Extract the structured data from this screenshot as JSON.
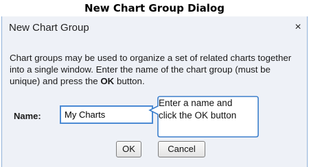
{
  "page": {
    "title": "New Chart Group Dialog"
  },
  "dialog": {
    "title": "New Chart Group",
    "close_glyph": "×",
    "message_part1": "Chart groups may be used to organize a set of related charts together into a single window. Enter the name of the chart group (must be unique) and press the ",
    "message_bold": "OK",
    "message_part2": " button.",
    "name_label": "Name:",
    "name_value": "My Charts",
    "callout_line1": "Enter a name and",
    "callout_line2": "click the OK button",
    "ok_label": "OK",
    "cancel_label": "Cancel"
  },
  "colors": {
    "dialog_background": "#eef1f7",
    "dialog_border": "#8fb0d8",
    "input_focus_border": "#4a8ad4",
    "callout_border": "#3b7ecb"
  },
  "icons": {
    "close": "close-icon"
  }
}
